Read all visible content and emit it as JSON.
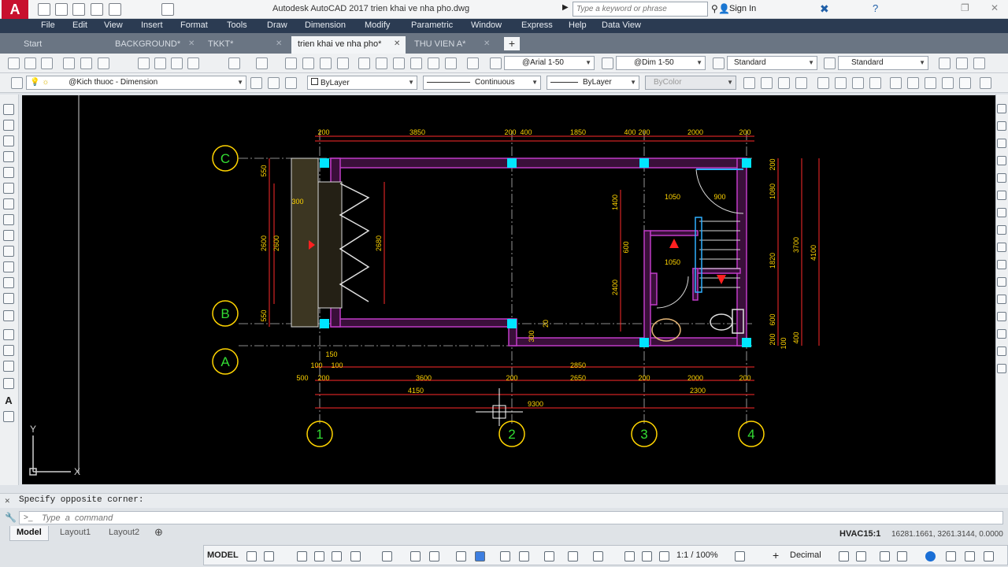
{
  "app": {
    "logo_letter": "A",
    "window_title": "Autodesk AutoCAD 2017    trien khai ve nha pho.dwg",
    "search_placeholder": "Type a keyword or phrase",
    "sign_in": "Sign In"
  },
  "menu": [
    "File",
    "Edit",
    "View",
    "Insert",
    "Format",
    "Tools",
    "Draw",
    "Dimension",
    "Modify",
    "Parametric",
    "Window",
    "Express",
    "Help",
    "Data View"
  ],
  "doc_tabs": [
    {
      "label": "Start"
    },
    {
      "label": "BACKGROUND*"
    },
    {
      "label": "TKKT*"
    },
    {
      "label": "trien khai ve nha pho*"
    },
    {
      "label": "THU VIEN A*"
    }
  ],
  "toolbar1": {
    "text_style": "@Arial 1-50",
    "dim_style": "@Dim 1-50",
    "table_style": "Standard",
    "multileader_style": "Standard"
  },
  "toolbar2": {
    "layer": "@Kich thuoc - Dimension",
    "color": "ByLayer",
    "linetype": "Continuous",
    "lineweight": "ByLayer",
    "plotstyle": "ByColor"
  },
  "drawing": {
    "grid_bubbles_row": [
      "C",
      "B",
      "A"
    ],
    "grid_bubbles_col": [
      "1",
      "2",
      "3",
      "4"
    ],
    "ucs": {
      "x": "X",
      "y": "Y"
    },
    "dims_top": [
      "200",
      "3850",
      "200",
      "400",
      "1850",
      "400",
      "200",
      "2000",
      "200"
    ],
    "dims_bottom_row1": [
      "150"
    ],
    "dims_bottom_row2": [
      "100",
      "100",
      "2850"
    ],
    "dims_bottom_row3": [
      "500",
      "200",
      "3600",
      "200",
      "2650",
      "200",
      "2000",
      "200"
    ],
    "dims_bottom_row4": [
      "4150",
      "2300"
    ],
    "dims_bottom_total": "9300",
    "dims_left_outer": [
      "550",
      "2600",
      "550"
    ],
    "dims_left_inner": [
      "300",
      "2600"
    ],
    "dims_stair": [
      "2680"
    ],
    "dims_right": [
      "200",
      "1080",
      "1820",
      "600",
      "100",
      "3700",
      "4100",
      "400",
      "200"
    ],
    "dims_interior": [
      "1050",
      "900",
      "1050",
      "1400",
      "600",
      "2400",
      "20",
      "300"
    ]
  },
  "command": {
    "history": "Specify opposite corner:",
    "placeholder": "Type  a  command"
  },
  "layout_tabs": [
    "Model",
    "Layout1",
    "Layout2"
  ],
  "status": {
    "coords": "16281.1661, 3261.3144, 0.0000",
    "annotation_scale_label": "HVAC15:1",
    "model": "MODEL",
    "scale": "1:1 / 100%",
    "units": "Decimal"
  }
}
